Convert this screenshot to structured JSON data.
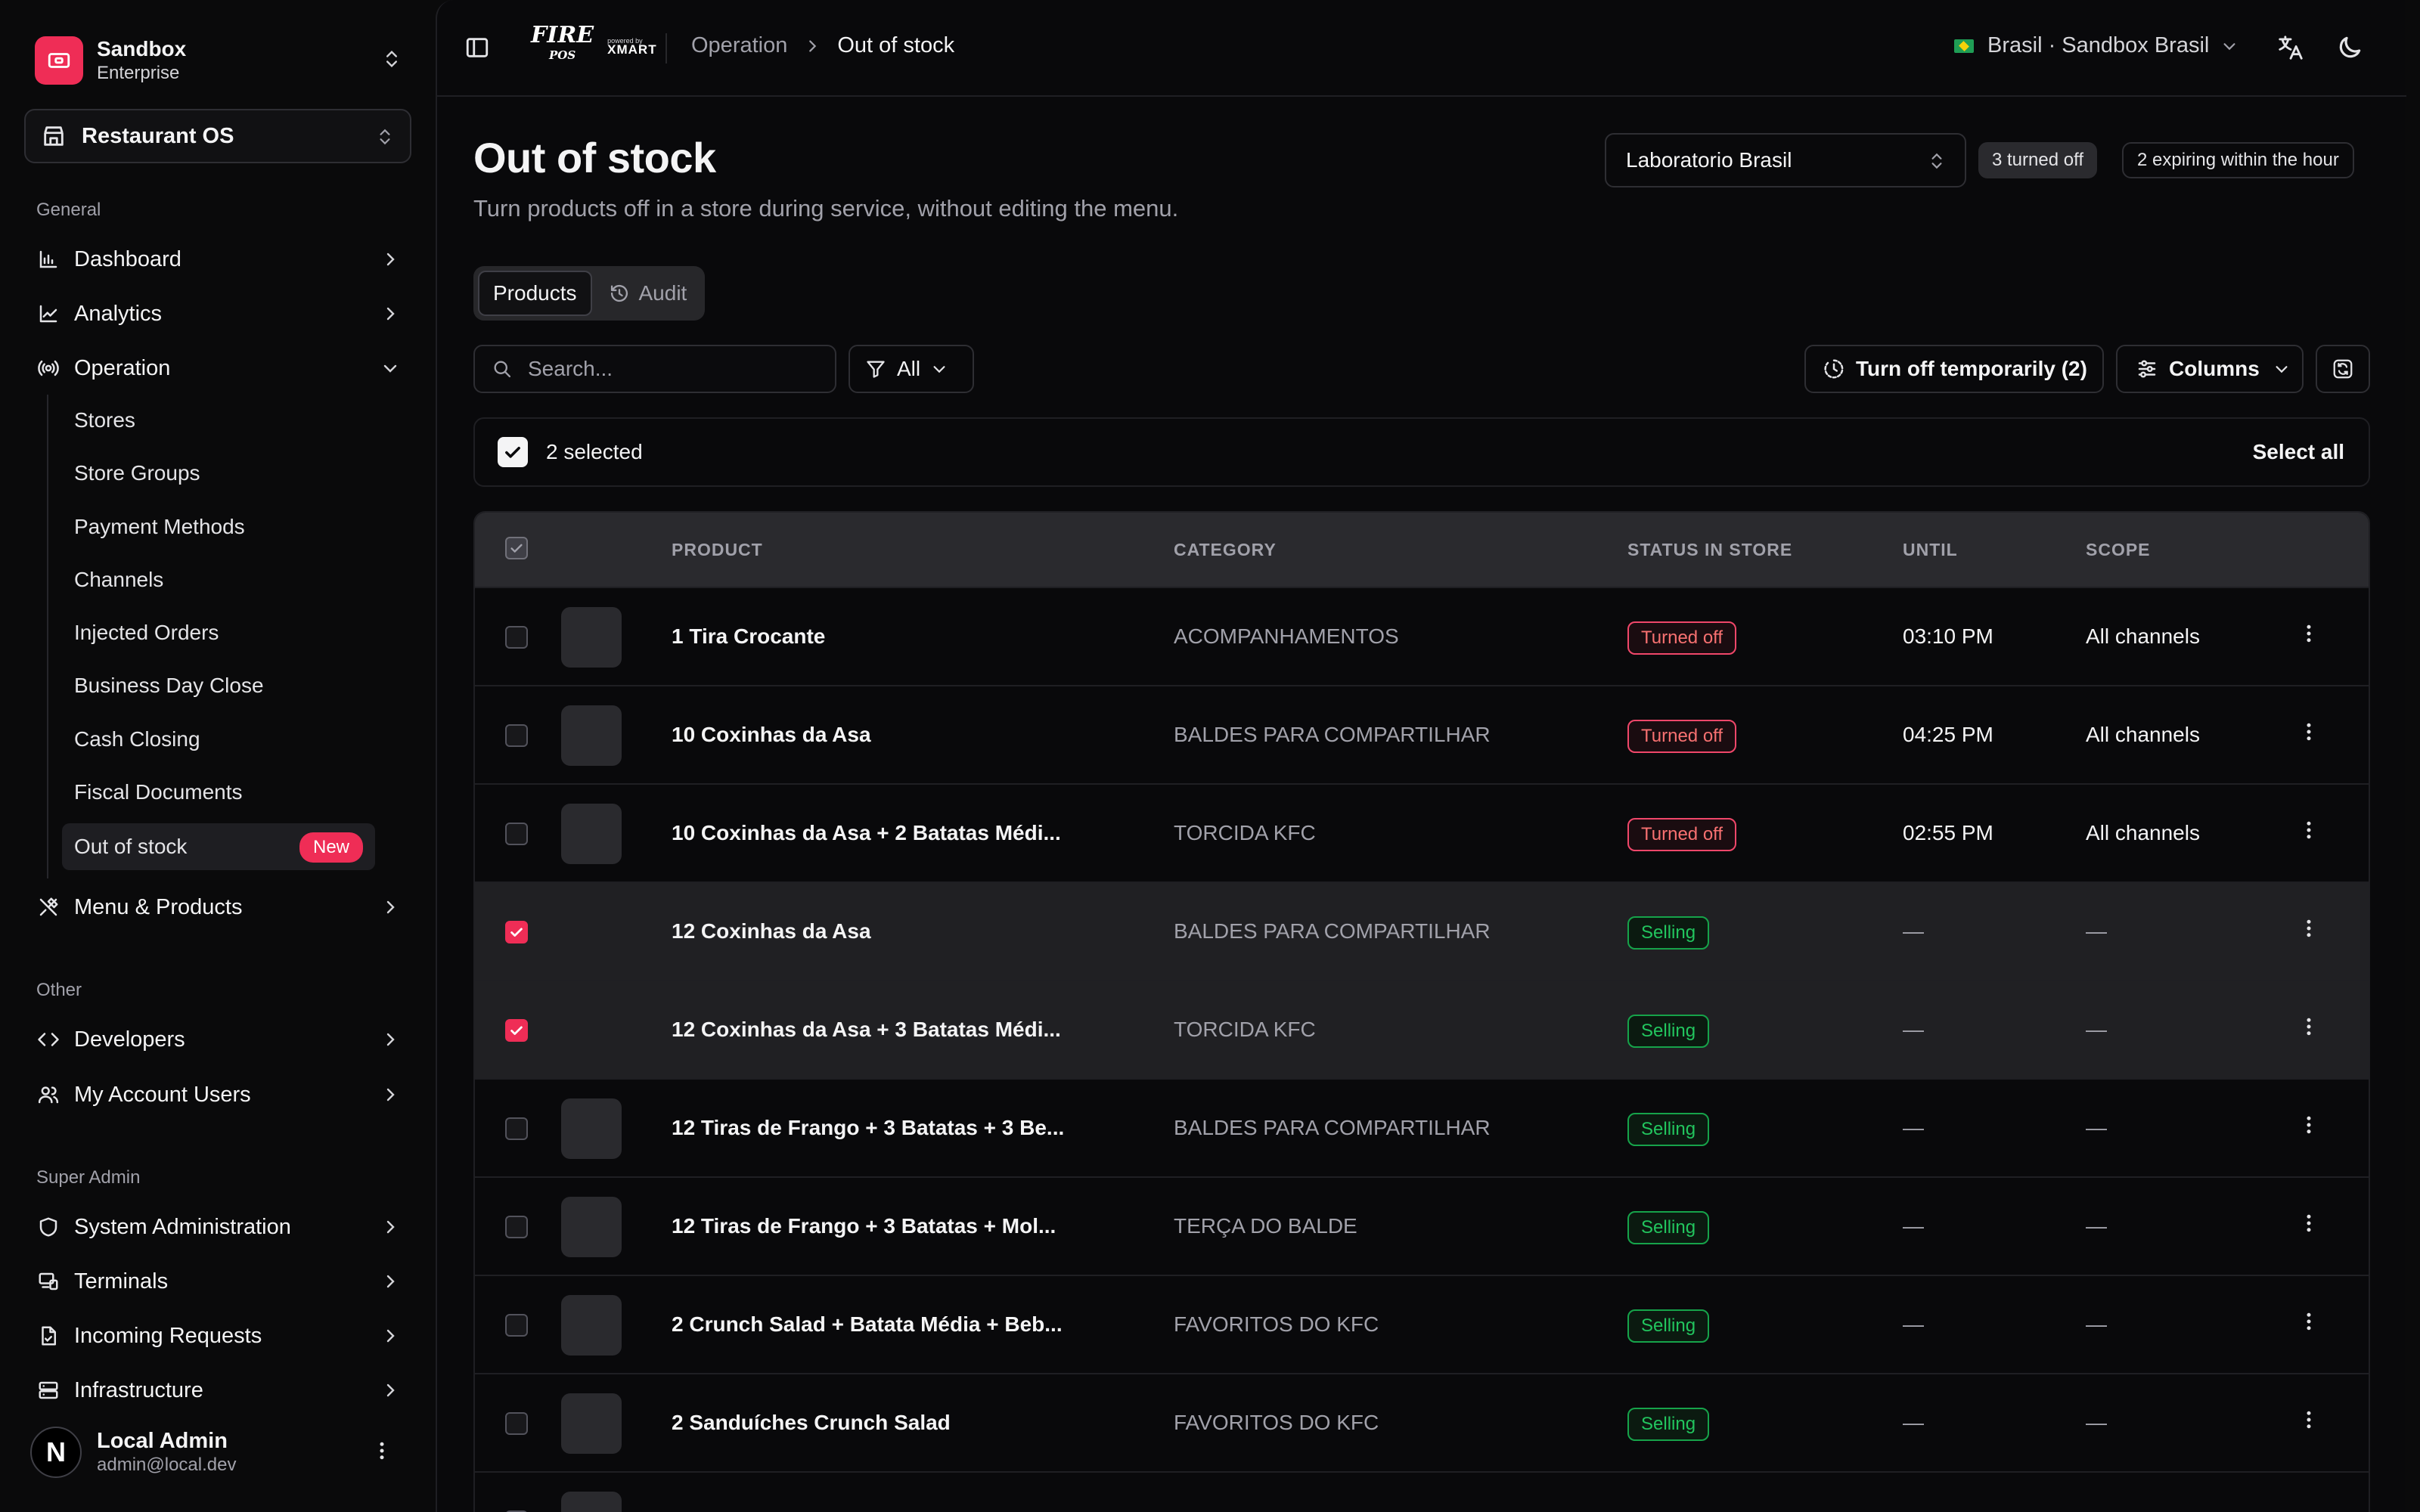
{
  "brand": {
    "name": "Sandbox",
    "plan": "Enterprise"
  },
  "org_select": {
    "label": "Restaurant OS"
  },
  "sidebar": {
    "general_label": "General",
    "general": [
      {
        "label": "Dashboard",
        "icon": "bar-chart-icon"
      },
      {
        "label": "Analytics",
        "icon": "line-chart-icon"
      },
      {
        "label": "Operation",
        "icon": "radio-icon"
      }
    ],
    "operation_items": [
      "Stores",
      "Store Groups",
      "Payment Methods",
      "Channels",
      "Injected Orders",
      "Business Day Close",
      "Cash Closing",
      "Fiscal Documents",
      "Out of stock"
    ],
    "new_badge": "New",
    "menu_products": "Menu & Products",
    "other_label": "Other",
    "other": [
      {
        "label": "Developers",
        "icon": "code-icon"
      },
      {
        "label": "My Account Users",
        "icon": "users-icon"
      }
    ],
    "super_admin_label": "Super Admin",
    "super_admin": [
      {
        "label": "System Administration",
        "icon": "shield-icon"
      },
      {
        "label": "Terminals",
        "icon": "devices-icon"
      },
      {
        "label": "Incoming Requests",
        "icon": "file-icon"
      },
      {
        "label": "Infrastructure",
        "icon": "server-icon"
      }
    ],
    "user": {
      "initial": "N",
      "name": "Local Admin",
      "email": "admin@local.dev"
    }
  },
  "topbar": {
    "logo_fire": "FIRE",
    "logo_pos": "POS",
    "logo_powered": "powered by",
    "logo_xmart": "XMART",
    "breadcrumb": [
      "Operation",
      "Out of stock"
    ],
    "region": "Brasil · Sandbox Brasil"
  },
  "page": {
    "title": "Out of stock",
    "subtitle": "Turn products off in a store during service, without editing the menu.",
    "store": "Laboratorio Brasil",
    "turned_off_badge": "3 turned off",
    "expiring_badge": "2 expiring within the hour"
  },
  "tabs": [
    "Products",
    "Audit"
  ],
  "toolbar": {
    "search_placeholder": "Search...",
    "filter": "All",
    "turn_off": "Turn off temporarily (2)",
    "columns": "Columns"
  },
  "selection": {
    "label": "2 selected",
    "select_all": "Select all"
  },
  "table": {
    "columns": [
      "PRODUCT",
      "CATEGORY",
      "STATUS IN STORE",
      "UNTIL",
      "SCOPE"
    ],
    "rows": [
      {
        "product": "1 Tira Crocante",
        "category": "ACOMPANHAMENTOS",
        "status": "Turned off",
        "until": "03:10 PM",
        "scope": "All channels",
        "selected": false
      },
      {
        "product": "10 Coxinhas da Asa",
        "category": "BALDES PARA COMPARTILHAR",
        "status": "Turned off",
        "until": "04:25 PM",
        "scope": "All channels",
        "selected": false
      },
      {
        "product": "10 Coxinhas da Asa + 2 Batatas Médi...",
        "category": "TORCIDA KFC",
        "status": "Turned off",
        "until": "02:55 PM",
        "scope": "All channels",
        "selected": false
      },
      {
        "product": "12 Coxinhas da Asa",
        "category": "BALDES PARA COMPARTILHAR",
        "status": "Selling",
        "until": "—",
        "scope": "—",
        "selected": true
      },
      {
        "product": "12 Coxinhas da Asa + 3 Batatas Médi...",
        "category": "TORCIDA KFC",
        "status": "Selling",
        "until": "—",
        "scope": "—",
        "selected": true
      },
      {
        "product": "12 Tiras de Frango + 3 Batatas + 3 Be...",
        "category": "BALDES PARA COMPARTILHAR",
        "status": "Selling",
        "until": "—",
        "scope": "—",
        "selected": false
      },
      {
        "product": "12 Tiras de Frango + 3 Batatas + Mol...",
        "category": "TERÇA DO BALDE",
        "status": "Selling",
        "until": "—",
        "scope": "—",
        "selected": false
      },
      {
        "product": "2 Crunch Salad + Batata Média + Beb...",
        "category": "FAVORITOS DO KFC",
        "status": "Selling",
        "until": "—",
        "scope": "—",
        "selected": false
      },
      {
        "product": "2 Sanduíches Crunch Salad",
        "category": "FAVORITOS DO KFC",
        "status": "Selling",
        "until": "—",
        "scope": "—",
        "selected": false
      }
    ]
  },
  "colors": {
    "accent": "#ef2d56",
    "turned_off": "#f87171",
    "selling": "#22c55e"
  }
}
